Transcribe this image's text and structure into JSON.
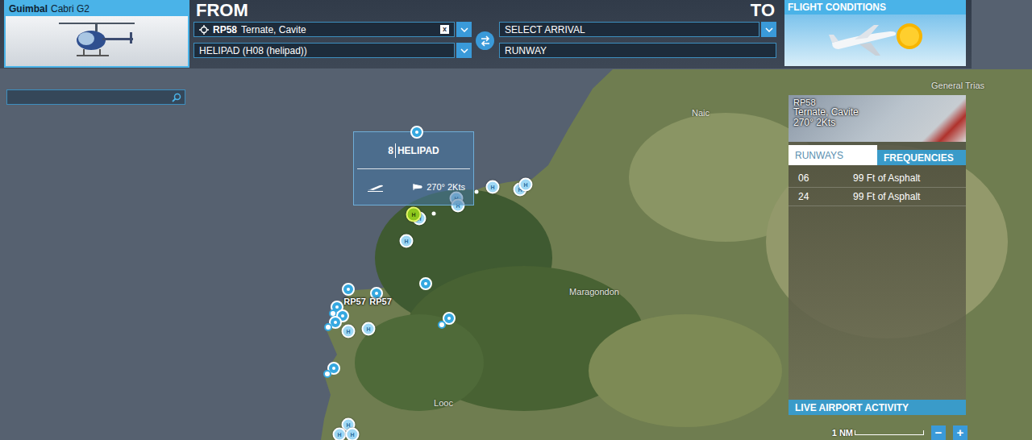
{
  "aircraft": {
    "make": "Guimbal",
    "model": "Cabri G2"
  },
  "from": {
    "heading": "FROM",
    "airport_code": "RP58",
    "airport_name": "Ternate, Cavite",
    "clear": "x",
    "parking": "HELIPAD (H08 (helipad))"
  },
  "to": {
    "heading": "TO",
    "arrival": "SELECT ARRIVAL",
    "runway": "RUNWAY"
  },
  "flight_conditions": {
    "label": "FLIGHT CONDITIONS"
  },
  "map": {
    "labels": [
      {
        "text": "General Trias"
      },
      {
        "text": "Naic"
      },
      {
        "text": "Maragondon"
      },
      {
        "text": "Looc"
      }
    ],
    "airport_labels": [
      {
        "text": "RP57"
      },
      {
        "text": "RP57"
      }
    ],
    "popup": {
      "number": "8",
      "title": "HELIPAD",
      "wind": "270° 2Kts"
    },
    "pins": [
      {
        "kind": "helipad",
        "glyph": "H",
        "selected": false
      },
      {
        "kind": "helipad",
        "glyph": "H",
        "selected": false
      },
      {
        "kind": "helipad",
        "glyph": "H",
        "selected": false
      },
      {
        "kind": "helipad",
        "glyph": "H",
        "selected": false
      },
      {
        "kind": "helipad",
        "glyph": "H",
        "selected": false
      },
      {
        "kind": "dot",
        "glyph": "",
        "selected": false
      },
      {
        "kind": "dot",
        "glyph": "",
        "selected": false
      },
      {
        "kind": "helipad",
        "glyph": "H",
        "selected": false
      },
      {
        "kind": "helipad",
        "glyph": "H",
        "selected": true
      },
      {
        "kind": "helipad",
        "glyph": "H",
        "selected": false
      },
      {
        "kind": "poi",
        "glyph": "",
        "selected": false
      },
      {
        "kind": "poi",
        "glyph": "",
        "selected": false
      },
      {
        "kind": "poi",
        "glyph": "",
        "selected": false
      },
      {
        "kind": "poi",
        "glyph": "",
        "selected": false
      },
      {
        "kind": "small",
        "glyph": "",
        "selected": false
      },
      {
        "kind": "poi",
        "glyph": "",
        "selected": false
      },
      {
        "kind": "poi",
        "glyph": "",
        "selected": false
      },
      {
        "kind": "small",
        "glyph": "",
        "selected": false
      },
      {
        "kind": "helipad",
        "glyph": "H",
        "selected": false
      },
      {
        "kind": "helipad",
        "glyph": "H",
        "selected": false
      },
      {
        "kind": "poi",
        "glyph": "",
        "selected": false
      },
      {
        "kind": "small",
        "glyph": "",
        "selected": false
      },
      {
        "kind": "poi",
        "glyph": "",
        "selected": false
      },
      {
        "kind": "small",
        "glyph": "",
        "selected": false
      },
      {
        "kind": "helipad",
        "glyph": "H",
        "selected": false
      },
      {
        "kind": "helipad",
        "glyph": "H",
        "selected": false
      },
      {
        "kind": "helipad",
        "glyph": "H",
        "selected": false
      }
    ],
    "scale": "1 NM"
  },
  "airport_panel": {
    "code": "RP58",
    "name": "Ternate, Cavite",
    "wind": "270° 2Kts",
    "tabs": [
      {
        "label": "RUNWAYS",
        "selected": true
      },
      {
        "label": "FREQUENCIES",
        "selected": false
      }
    ],
    "runways": [
      {
        "id": "06",
        "surface": "99 Ft of Asphalt"
      },
      {
        "id": "24",
        "surface": "99 Ft of Asphalt"
      }
    ],
    "footer": "LIVE AIRPORT ACTIVITY"
  },
  "zoom": {
    "out": "−",
    "in": "+"
  }
}
